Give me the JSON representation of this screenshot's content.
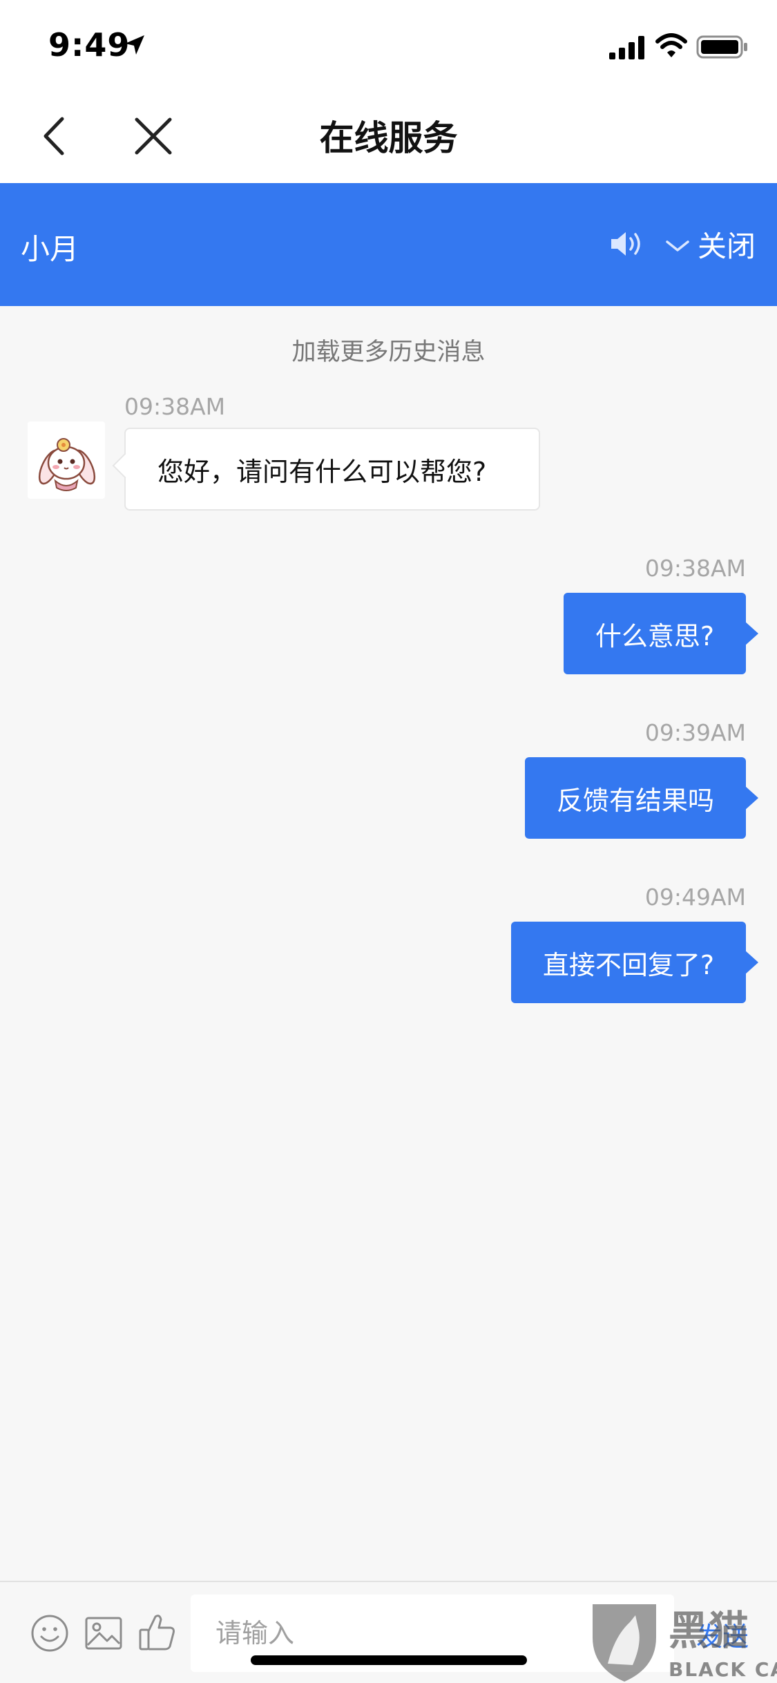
{
  "status_bar": {
    "time": "9:49"
  },
  "nav": {
    "title": "在线服务"
  },
  "agent_header": {
    "name": "小月",
    "collapse_label": "关闭"
  },
  "chat": {
    "load_more": "加载更多历史消息",
    "messages": [
      {
        "from": "agent",
        "time": "09:38AM",
        "text": "您好，请问有什么可以帮您?"
      },
      {
        "from": "user",
        "time": "09:38AM",
        "text": "什么意思?"
      },
      {
        "from": "user",
        "time": "09:39AM",
        "text": "反馈有结果吗"
      },
      {
        "from": "user",
        "time": "09:49AM",
        "text": "直接不回复了?"
      }
    ]
  },
  "input_bar": {
    "placeholder": "请输入",
    "send_label": "发送"
  },
  "watermark": {
    "text": "黑猫",
    "subtext": "BLACK CAT"
  },
  "colors": {
    "accent": "#3478f0",
    "background": "#f7f7f7",
    "timestamp": "#a6a6a6"
  },
  "icons": [
    "location-arrow-icon",
    "signal-icon",
    "wifi-icon",
    "battery-icon",
    "back-icon",
    "close-icon",
    "speaker-icon",
    "chevron-down-icon",
    "emoji-icon",
    "image-icon",
    "thumbs-up-icon"
  ]
}
